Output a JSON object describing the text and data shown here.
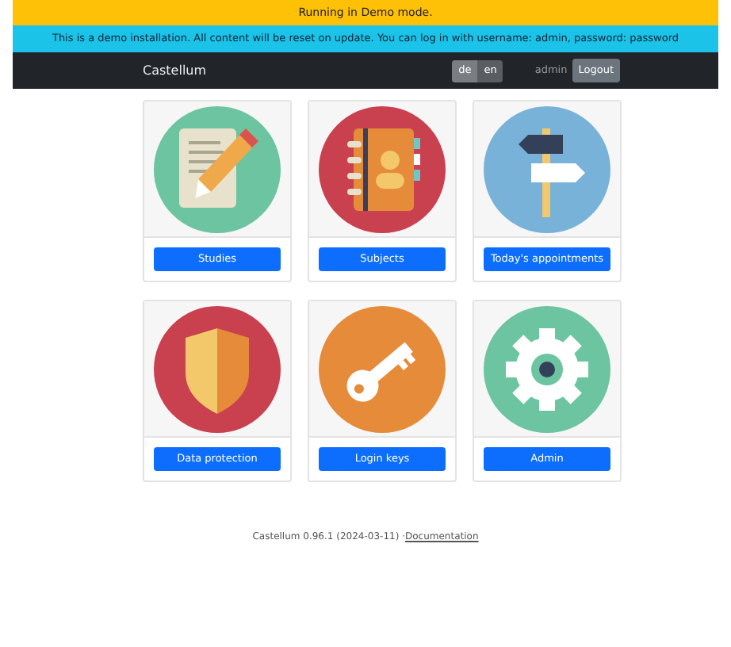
{
  "demo_banner": "Running in Demo mode.",
  "info_banner": "This is a demo installation. All content will be reset on update. You can log in with username: admin, password: password",
  "navbar": {
    "brand": "Castellum",
    "languages": [
      {
        "label": "de",
        "selected": true
      },
      {
        "label": "en",
        "selected": false
      }
    ],
    "user": "admin",
    "logout": "Logout"
  },
  "tiles": [
    {
      "kind": "notepad",
      "label": "Studies"
    },
    {
      "kind": "addressbook",
      "label": "Subjects"
    },
    {
      "kind": "signpost",
      "label": "Today's appointments"
    },
    {
      "kind": "shield",
      "label": "Data protection"
    },
    {
      "kind": "key",
      "label": "Login keys"
    },
    {
      "kind": "gear",
      "label": "Admin"
    }
  ],
  "footer": {
    "version": "Castellum 0.96.1 (2024-03-11) · ",
    "link": "Documentation"
  }
}
